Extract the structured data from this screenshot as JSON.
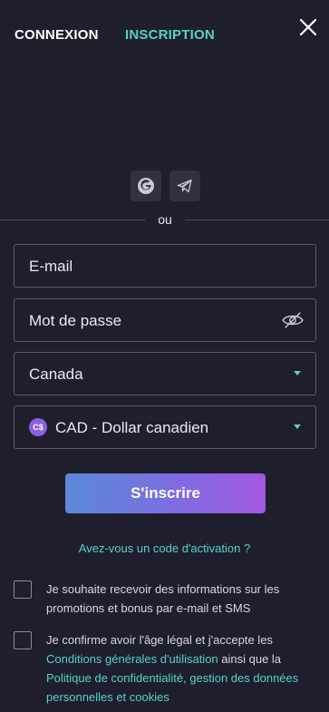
{
  "header": {
    "tab_login": "CONNEXION",
    "tab_register": "INSCRIPTION"
  },
  "social": {
    "icons": [
      "google-icon",
      "telegram-icon"
    ]
  },
  "divider": {
    "text": "ou"
  },
  "form": {
    "email_placeholder": "E-mail",
    "password_placeholder": "Mot de passe",
    "country_value": "Canada",
    "currency_badge": "C$",
    "currency_value": "CAD - Dollar canadien",
    "submit_label": "S'inscrire"
  },
  "activation_link": "Avez-vous un code d'activation ?",
  "consent": {
    "promo_text": "Je souhaite recevoir des informations sur les promotions et bonus par e-mail et SMS",
    "legal_prefix": "Je confirme avoir l'âge légal et j'accepte les ",
    "terms_link": "Conditions générales d'utilisation",
    "legal_middle": " ainsi que la ",
    "privacy_link": "Politique de confidentialité, gestion des données personnelles et cookies"
  },
  "colors": {
    "background": "#1f1e2c",
    "accent": "#55d2c9",
    "button_gradient_start": "#5b8ad8",
    "button_gradient_end": "#a257e3"
  }
}
